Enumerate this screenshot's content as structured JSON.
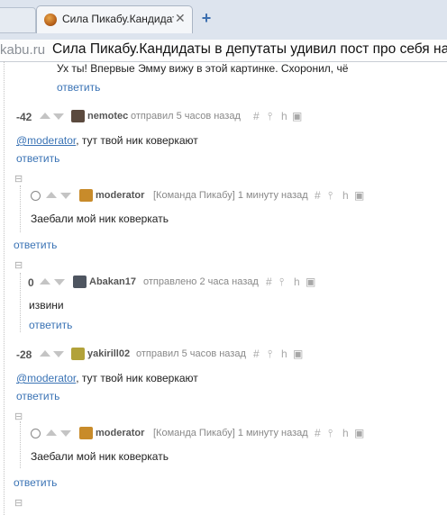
{
  "browser": {
    "active_tab_title": "Сила Пикабу.Кандидат",
    "tab_close_glyph": "✕",
    "new_tab_glyph": "+",
    "address_domain": "kabu.ru",
    "page_title": "Сила Пикабу.Кандидаты в депутаты удивил пост про себя на"
  },
  "comments": {
    "top_snippet": "Ух ты! Впервые Эмму вижу в этой картинке. Схоронил, чё",
    "reply_label": "ответить",
    "tool_hash": "#",
    "tool_pin": "⫯",
    "tool_branch": "h",
    "tool_save": "▣",
    "collapse_glyph": "⊟",
    "c1": {
      "rating": "-42",
      "user": "nemotec",
      "meta": "отправил 5 часов назад",
      "mention": "@moderator",
      "text": ", тут твой ник коверкают"
    },
    "c2": {
      "user": "moderator",
      "meta": "[Команда Пикабу] 1 минуту назад",
      "text": "Заебали мой ник коверкать"
    },
    "c3": {
      "rating": "0",
      "user": "Abakan17",
      "meta": "отправлено 2 часа назад",
      "text": "извини"
    },
    "c4": {
      "rating": "-28",
      "user": "yakirill02",
      "meta": "отправил 5 часов назад",
      "mention": "@moderator",
      "text": ", тут твой ник коверкают"
    },
    "c5": {
      "user": "moderator",
      "meta": "[Команда Пикабу] 1 минуту назад",
      "text": "Заебали мой ник коверкать"
    }
  },
  "colors": {
    "link": "#3a73b5",
    "tabstrip": "#dde4ee"
  }
}
